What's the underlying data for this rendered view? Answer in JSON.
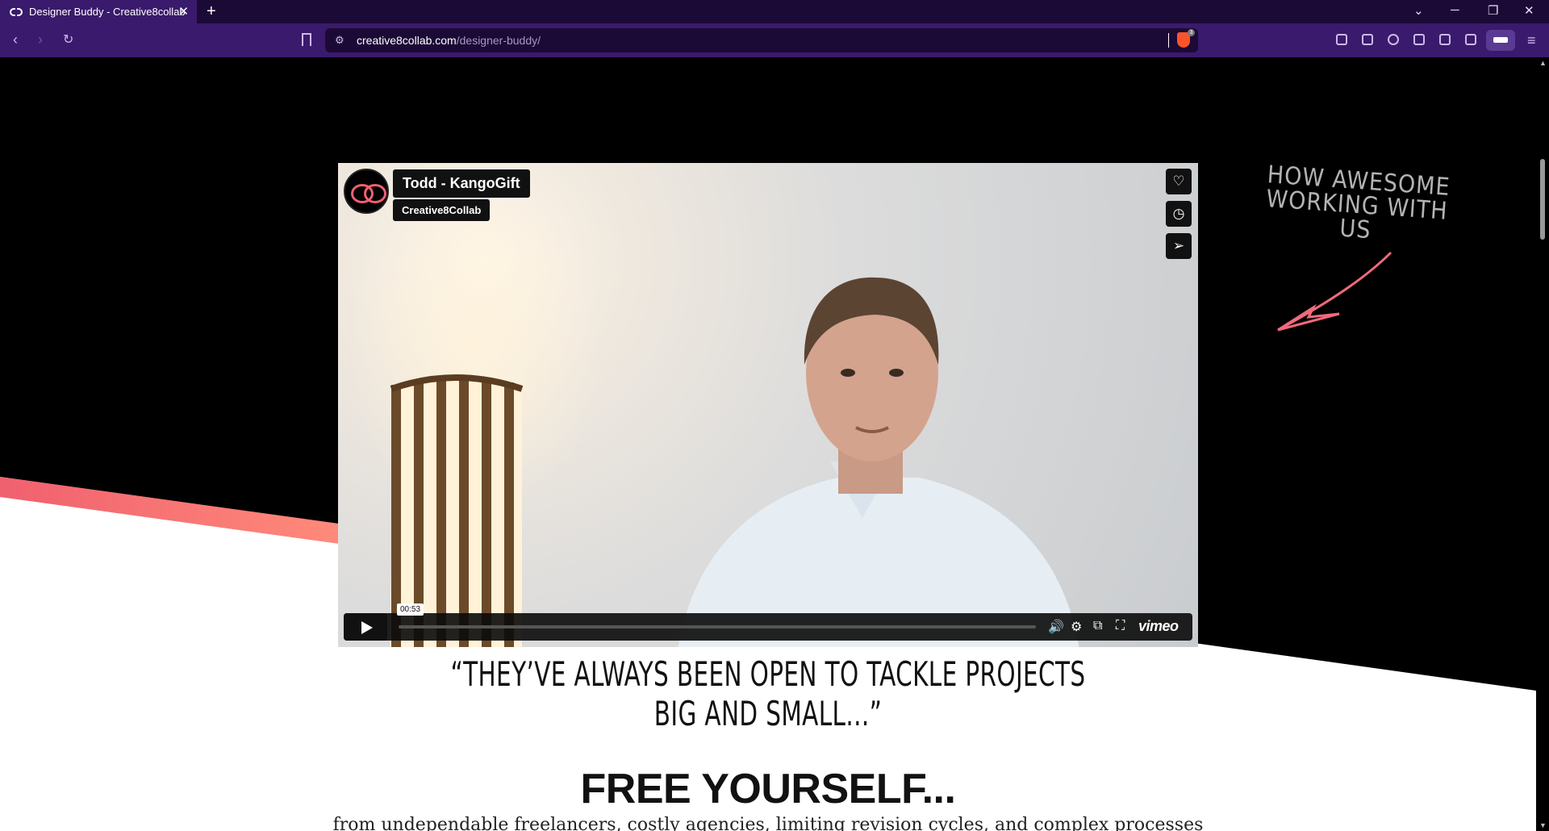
{
  "browser": {
    "tab_title": "Designer Buddy - Creative8collab",
    "new_tab_symbol": "+",
    "url_domain": "creative8collab.com",
    "url_path": "/designer-buddy/",
    "shield_count": "3"
  },
  "page": {
    "annotation": "HOW AWESOME WORKING WITH US",
    "quote": "“They’ve always been open to tackle projects big and small...”",
    "heading": "FREE YOURSELF...",
    "subheading": "from undependable freelancers, costly agencies, limiting revision cycles, and complex processes"
  },
  "video": {
    "title": "Todd - KangoGift",
    "author": "Creative8Collab",
    "time": "00:53",
    "progress": 0.0,
    "logo": "vimeo"
  },
  "colors": {
    "chrome_dark": "#1c0a36",
    "chrome": "#3a1a6c",
    "accent_pink": "#f06071",
    "brave_orange": "#fb542b"
  }
}
